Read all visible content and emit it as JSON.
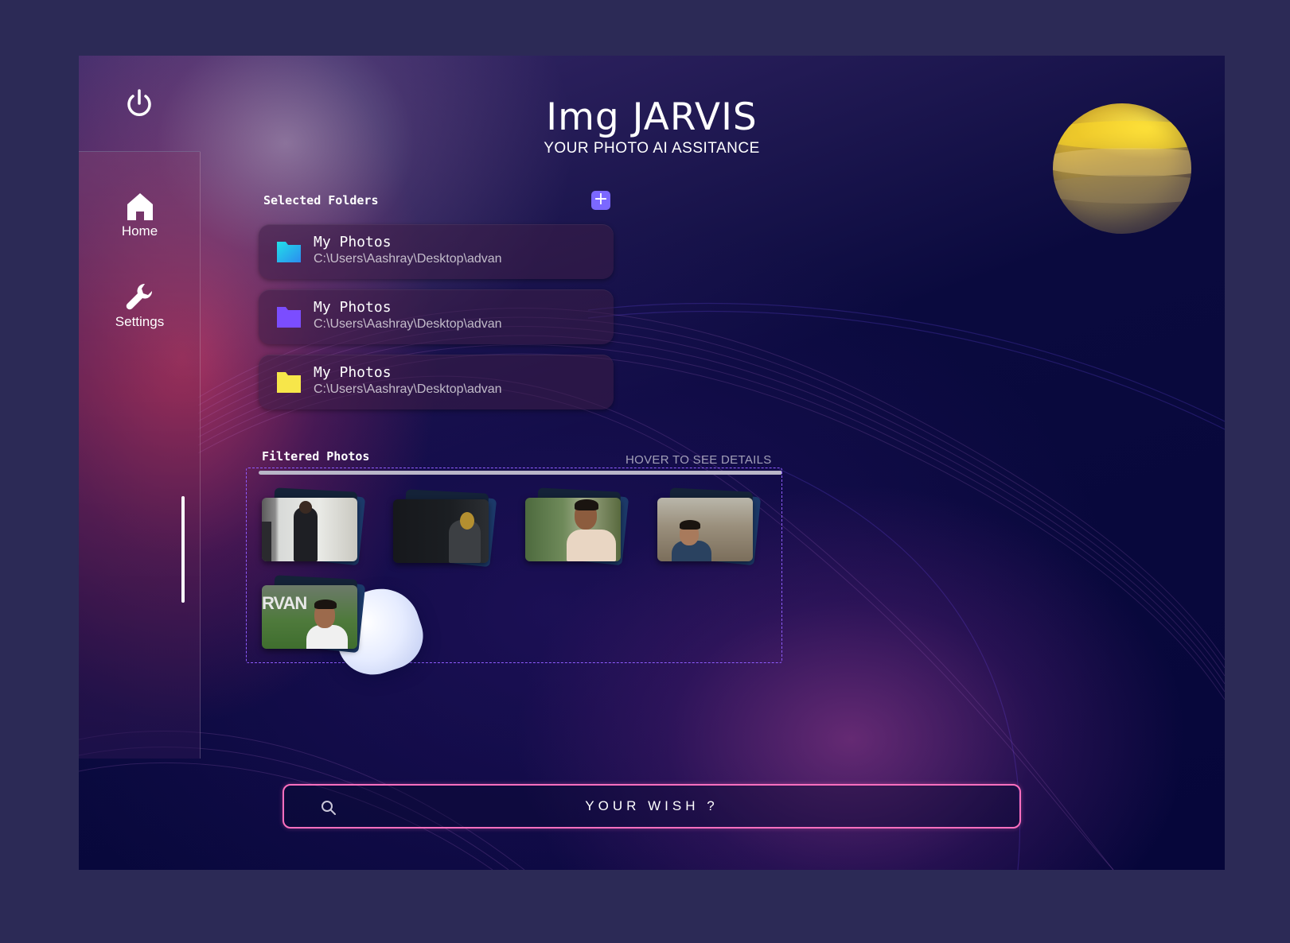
{
  "app": {
    "title": "Img JARVIS",
    "subtitle": "YOUR PHOTO AI ASSITANCE"
  },
  "sidebar": {
    "items": [
      {
        "label": "Home",
        "icon": "home-icon"
      },
      {
        "label": "Settings",
        "icon": "wrench-icon"
      }
    ]
  },
  "selected_folders": {
    "label": "Selected Folders",
    "add_icon": "plus-icon",
    "items": [
      {
        "name": "My Photos",
        "path": "C:\\Users\\Aashray\\Desktop\\advan",
        "color": "#22c7e8"
      },
      {
        "name": "My Photos",
        "path": "C:\\Users\\Aashray\\Desktop\\advan",
        "color": "#7b4dff"
      },
      {
        "name": "My Photos",
        "path": "C:\\Users\\Aashray\\Desktop\\advan",
        "color": "#f7e64a"
      }
    ]
  },
  "filtered_photos": {
    "label": "Filtered Photos",
    "hint": "HOVER TO SEE DETAILS",
    "count": 5
  },
  "search": {
    "placeholder": "YOUR WISH ?"
  },
  "colors": {
    "accent": "#7b68ff",
    "search_border": "#ff6fbf",
    "dashed_border": "#8f5cff"
  }
}
